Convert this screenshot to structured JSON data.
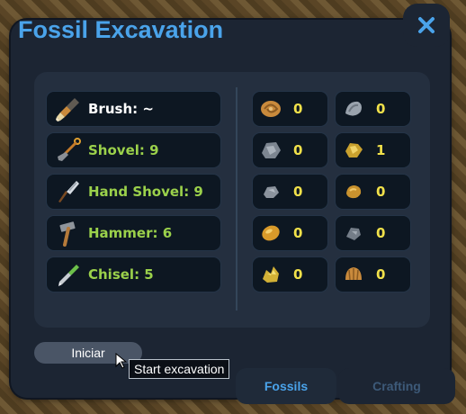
{
  "window": {
    "title_part1": "Fossil",
    "title_part2": "Excavation",
    "close_icon": "close-icon",
    "accent_color": "#4aa3ea"
  },
  "tools": [
    {
      "icon": "brush-icon",
      "label": "Brush: ~",
      "color": "#ffffff"
    },
    {
      "icon": "shovel-icon",
      "label": "Shovel: 9",
      "color": "#9bd14b"
    },
    {
      "icon": "hand-shovel-icon",
      "label": "Hand Shovel: 9",
      "color": "#9bd14b"
    },
    {
      "icon": "hammer-icon",
      "label": "Hammer: 6",
      "color": "#9bd14b"
    },
    {
      "icon": "chisel-icon",
      "label": "Chisel: 5",
      "color": "#9bd14b"
    }
  ],
  "fossils": [
    {
      "icon": "ammonite-fossil-icon",
      "count": "0"
    },
    {
      "icon": "gray-shell-fossil-icon",
      "count": "0"
    },
    {
      "icon": "gray-rock-fossil-icon",
      "count": "0"
    },
    {
      "icon": "gold-ore-fossil-icon",
      "count": "1"
    },
    {
      "icon": "gray-stone-fossil-icon",
      "count": "0"
    },
    {
      "icon": "gold-nugget-fossil-icon",
      "count": "0"
    },
    {
      "icon": "amber-fossil-icon",
      "count": "0"
    },
    {
      "icon": "gray-pebble-fossil-icon",
      "count": "0"
    },
    {
      "icon": "gold-crystal-fossil-icon",
      "count": "0"
    },
    {
      "icon": "shell-fossil-icon",
      "count": "0"
    }
  ],
  "actions": {
    "start_label": "Iniciar",
    "tooltip": "Start excavation"
  },
  "tabs": [
    {
      "label": "Fossils",
      "active": true
    },
    {
      "label": "Crafting",
      "active": false
    }
  ]
}
